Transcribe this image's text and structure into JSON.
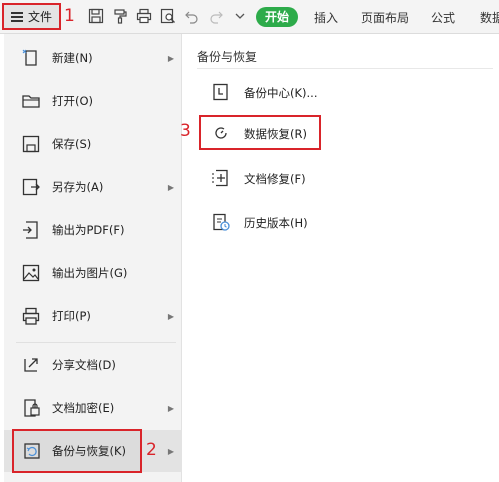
{
  "toolbar": {
    "file_label": "文件",
    "tabs": {
      "start": "开始",
      "insert": "插入",
      "layout": "页面布局",
      "formula": "公式",
      "data": "数据"
    }
  },
  "annotations": {
    "step1": "1",
    "step2": "2",
    "step3": "3"
  },
  "left_menu": {
    "items": [
      {
        "label": "新建(N)"
      },
      {
        "label": "打开(O)"
      },
      {
        "label": "保存(S)"
      },
      {
        "label": "另存为(A)"
      },
      {
        "label": "输出为PDF(F)"
      },
      {
        "label": "输出为图片(G)"
      },
      {
        "label": "打印(P)"
      },
      {
        "label": "分享文档(D)"
      },
      {
        "label": "文档加密(E)"
      },
      {
        "label": "备份与恢复(K)"
      }
    ]
  },
  "right_panel": {
    "title": "备份与恢复",
    "items": [
      {
        "label": "备份中心(K)..."
      },
      {
        "label": "数据恢复(R)"
      },
      {
        "label": "文档修复(F)"
      },
      {
        "label": "历史版本(H)"
      }
    ]
  },
  "colors": {
    "accent_green": "#2dab4a",
    "annotation_red": "#d9242a"
  }
}
